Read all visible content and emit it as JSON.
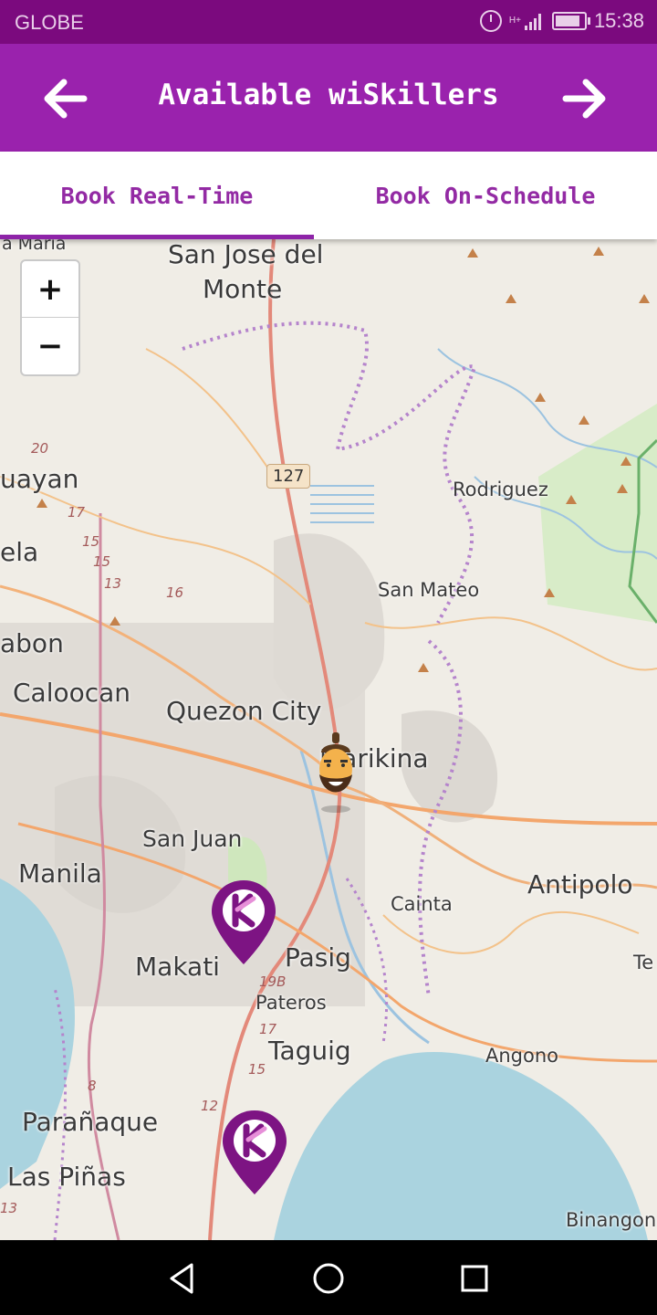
{
  "status_bar": {
    "carrier": "GLOBE",
    "network": "H+",
    "time": "15:38"
  },
  "header": {
    "title": "Available wiSkillers",
    "back_icon": "arrow-left-icon",
    "forward_icon": "arrow-right-icon"
  },
  "tabs": [
    {
      "label": "Book Real-Time",
      "selected": true
    },
    {
      "label": "Book On-Schedule",
      "selected": false
    }
  ],
  "map": {
    "zoom_in": "+",
    "zoom_out": "−",
    "places": {
      "san_jose": "San Jose del",
      "monte": "Monte",
      "sta_maria": "a Maria",
      "rodriguez": "Rodriguez",
      "san_mateo": "San Mateo",
      "quezon_city": "Quezon City",
      "marikina": "Marikina",
      "caloocan": "Caloocan",
      "san_juan": "San Juan",
      "manila": "Manila",
      "antipolo": "Antipolo",
      "cainta": "Cainta",
      "pasig": "Pasig",
      "makati": "Makati",
      "pateros": "Pateros",
      "taguig": "Taguig",
      "angono": "Angono",
      "paranaque": "Parañaque",
      "las_pinas": "Las Piñas",
      "binangon": "Binangon",
      "guayan": "uayan",
      "ela": "ela",
      "abon": "abon",
      "te": "Te"
    },
    "road_badge": "127",
    "road_numbers": [
      "20",
      "17",
      "15",
      "15",
      "13",
      "16",
      "19B",
      "17",
      "15",
      "12",
      "8",
      "13"
    ],
    "markers": [
      "wiskiller-pin-icon",
      "wiskiller-pin-icon",
      "user-avatar-icon"
    ]
  },
  "colors": {
    "status_bar": "#7b0a7e",
    "app_bar": "#9a22ad",
    "accent": "#932aa4",
    "water": "#aad3df"
  }
}
